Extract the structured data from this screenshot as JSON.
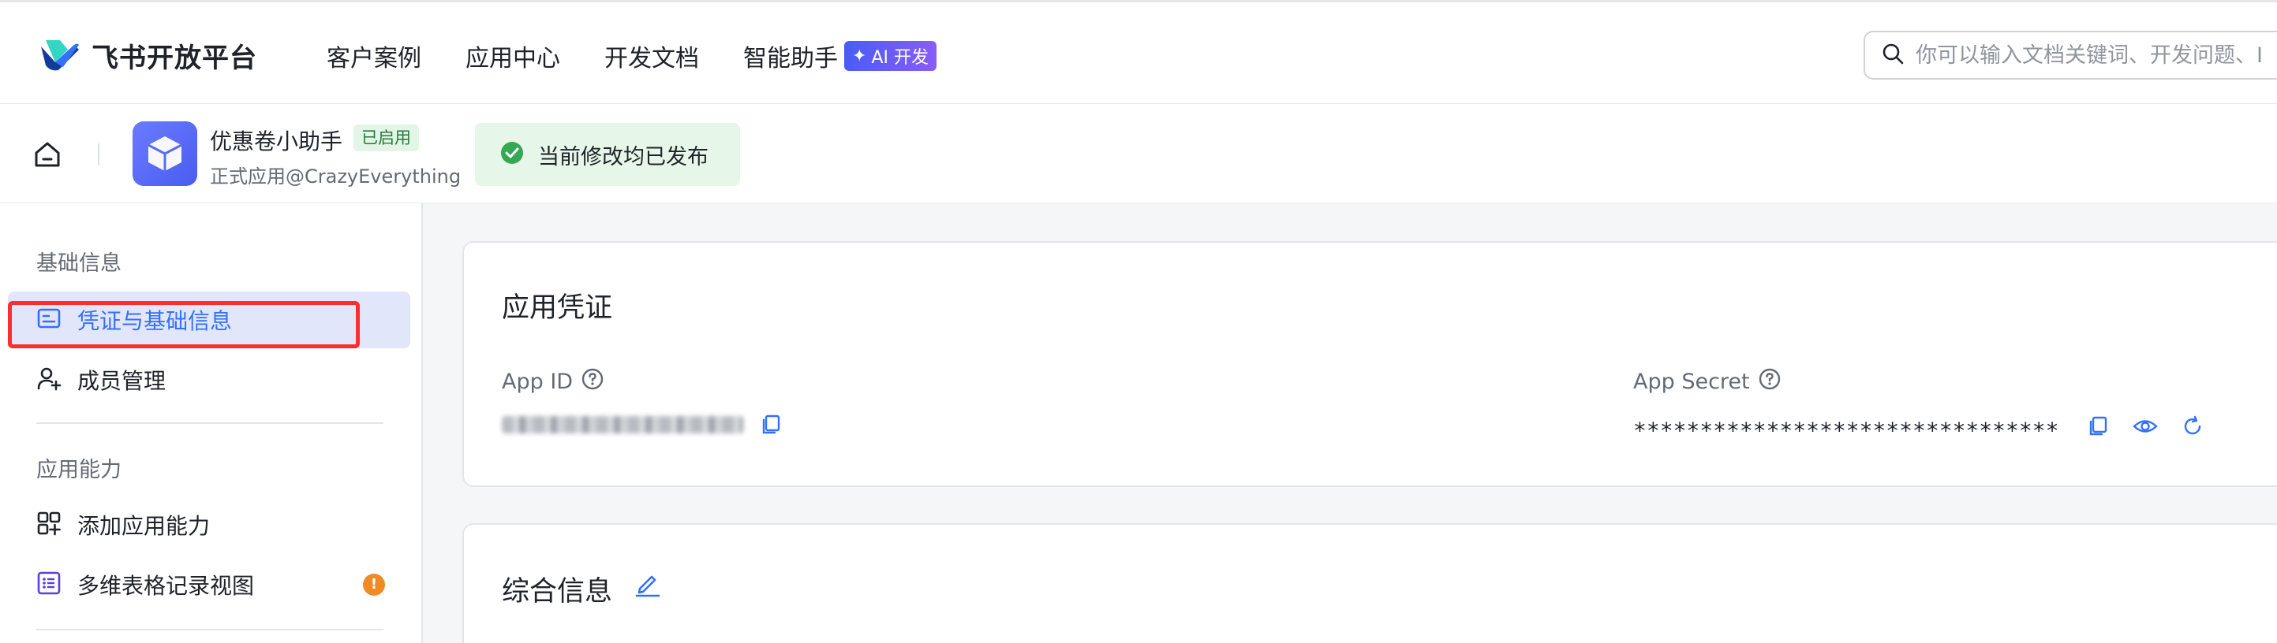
{
  "colors": {
    "accent": "#3370ff",
    "success": "#34a853",
    "warning": "#f08a24",
    "highlight": "#ff2d2d"
  },
  "topnav": {
    "logo_text": "飞书开放平台",
    "links": [
      "客户案例",
      "应用中心",
      "开发文档",
      "智能助手"
    ],
    "ai_badge": "AI 开发",
    "search_placeholder": "你可以输入文档关键词、开发问题、I"
  },
  "appbar": {
    "app_name": "优惠卷小助手",
    "status": "已启用",
    "subtitle": "正式应用@CrazyEverything",
    "published_text": "当前修改均已发布"
  },
  "sidebar": {
    "sections": [
      {
        "title": "基础信息",
        "items": [
          {
            "label": "凭证与基础信息",
            "icon": "credential-icon",
            "active": true
          },
          {
            "label": "成员管理",
            "icon": "member-add-icon"
          }
        ]
      },
      {
        "title": "应用能力",
        "items": [
          {
            "label": "添加应用能力",
            "icon": "apps-add-icon"
          },
          {
            "label": "多维表格记录视图",
            "icon": "list-view-icon",
            "badge": "!"
          }
        ]
      }
    ]
  },
  "main": {
    "credentials_card": {
      "title": "应用凭证",
      "app_id_label": "App ID",
      "app_secret_label": "App Secret",
      "app_secret_value": "********************************"
    },
    "info_card": {
      "title": "综合信息"
    }
  }
}
